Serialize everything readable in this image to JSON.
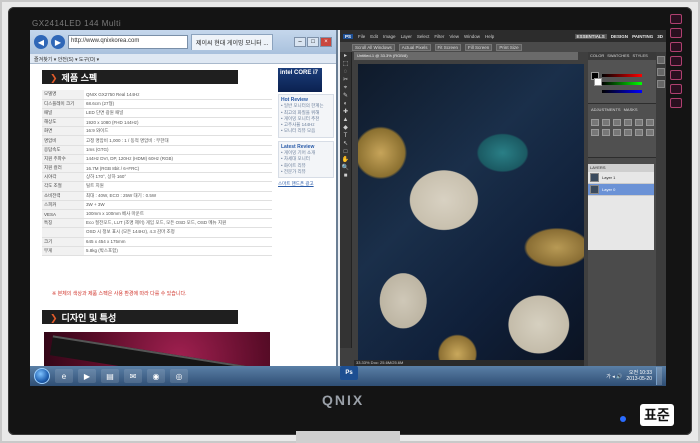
{
  "monitor": {
    "model_label": "GX2414LED 144 Multi",
    "brand": "QNIX",
    "watermark": "표준"
  },
  "browser": {
    "address": "http://www.qnixkorea.com",
    "tab_title": "제이씨 현대 게이밍 모니터 ...",
    "toolbar_text": "즐겨찾기 ▾ 안전(S) ▾ 도구(O) ▾",
    "sections": {
      "spec_title": "제품 스펙",
      "design_title": "디자인 및 특성"
    },
    "spec_rows": [
      {
        "k": "모델명",
        "v": "QNIX GX2750 Real 144Hz"
      },
      {
        "k": "디스플레이 크기",
        "v": "68.6cm (27형)"
      },
      {
        "k": "패널",
        "v": "LED 단면 광원 패널"
      },
      {
        "k": "해상도",
        "v": "1920 x 1080 (FHD 144Hz)"
      },
      {
        "k": "화면",
        "v": "16:9 와이드"
      },
      {
        "k": "명암비",
        "v": "고정 명암비 1,000 : 1 / 동적 명암비 : 무한대"
      },
      {
        "k": "응답속도",
        "v": "1ms (GTG)"
      },
      {
        "k": "지원 주파수",
        "v": "144Hz DVI, DP, 120Hz (HDMI) 60Hz (RGB)"
      },
      {
        "k": "지원 컬러",
        "v": "16.7M (RGB 8bit / 6+FRC)"
      },
      {
        "k": "시야각",
        "v": "상하 170°, 상하 160°"
      },
      {
        "k": "각도 조절",
        "v": "틸트 지원"
      },
      {
        "k": "소비전력",
        "v": "최대 : 40W, ECO : 25W 대기 : 0.5W"
      },
      {
        "k": "스피커",
        "v": "3W + 3W"
      },
      {
        "k": "VESA",
        "v": "100mm x 100mm 베사 마운트"
      },
      {
        "k": "특징",
        "v": "Eco 절전모드, LUT (조명 제어) 게임 모드, 모든 OSD 모드, OSD 메뉴 지원"
      },
      {
        "k": "",
        "v": "OSD 시 정보 표시 (모든 144Hz), 4.3 감마 조정"
      },
      {
        "k": "크기",
        "v": "645 x 454 x 175mm"
      },
      {
        "k": "무게",
        "v": "5.8kg (박스포함)"
      }
    ],
    "note": "※ 본체의 색상과 제품 스펙은 사용 환경에 따라 다를 수 있습니다.",
    "sidebar": {
      "intel": "intel CORE i7",
      "hot_review_title": "Hot Review",
      "hot_review_items": [
        "• 일반 모니터의 한계는",
        "• 최고의 화질을 위해",
        "• 게이밍 모니터 추천",
        "• 고주사율 144Hz",
        "• 모니터 리뷰 모음"
      ],
      "latest_review_title": "Latest Review",
      "latest_review_items": [
        "• 게이밍 기어 소개",
        "• 차세대 모니터",
        "• 화이트 리뷰",
        "• 전문가 리뷰"
      ],
      "link": "스마트 핸드폰 광고"
    }
  },
  "photoshop": {
    "menu": [
      "PS",
      "File",
      "Edit",
      "Image",
      "Layer",
      "Select",
      "Filter",
      "View",
      "Window",
      "Help"
    ],
    "workspaces": [
      "ESSENTIALS",
      "DESIGN",
      "PAINTING",
      "3D"
    ],
    "options": [
      "Scroll All Windows",
      "Actual Pixels",
      "Fit Screen",
      "Fill Screen",
      "Print Size"
    ],
    "doc_tab": "Untitled-1 @ 33.3% (RGB/8)",
    "status": "33.33%  Doc: 25.6M/25.6M",
    "panel_tabs": [
      "COLOR",
      "SWATCHES",
      "STYLES"
    ],
    "adj_tabs": [
      "ADJUSTMENTS",
      "MASKS"
    ],
    "layers_head": "LAYERS",
    "layers": [
      {
        "name": "Layer 1",
        "selected": false
      },
      {
        "name": "Layer 0",
        "selected": true
      }
    ]
  },
  "taskbar": {
    "tray": "가 ◂ 🔊",
    "time": "오전 10:33",
    "date": "2013-05-20"
  }
}
